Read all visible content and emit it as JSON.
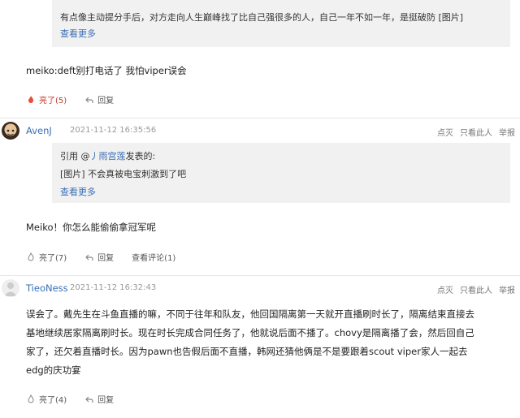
{
  "posts": [
    {
      "quote_text": "有点像主动提分手后，对方走向人生巅峰找了比自己强很多的人，自己一年不如一年，是挺破防 [图片]",
      "quote_more": "查看更多",
      "body": "meiko:deft别打电话了 我怕viper误会",
      "like_label": "亮了(5)",
      "reply_label": "回复"
    },
    {
      "username": "AvenJ",
      "timestamp": "2021-11-12 16:35:56",
      "links": [
        "点灭",
        "只看此人",
        "举报"
      ],
      "quote_prefix": "引用 @",
      "quote_user": "丿雨宫莲",
      "quote_suffix": "发表的:",
      "quote_text": "[图片] 不会真被电宝刺激到了吧",
      "quote_more": "查看更多",
      "body": "Meiko！你怎么能偷偷拿冠军呢",
      "like_label": "亮了(7)",
      "reply_label": "回复",
      "comments_label": "查看评论(1)"
    },
    {
      "username": "TieoNess",
      "timestamp": "2021-11-12 16:32:43",
      "links": [
        "点灭",
        "只看此人",
        "举报"
      ],
      "body_lines": [
        "误会了。戴先生在斗鱼直播的嘛，不同于往年和队友，他回国隔离第一天就开直播刷时长了，隔离结束直接去",
        "基地继续居家隔离刷时长。现在时长完成合同任务了，他就说后面不播了。chovy是隔离播了会，然后回自己",
        "家了，还欠着直播时长。因为pawn也告假后面不直播，韩网还猜他俩是不是要跟着scout viper家人一起去",
        "edg的庆功宴"
      ],
      "like_label": "亮了(4)",
      "reply_label": "回复"
    }
  ],
  "colors": {
    "link": "#3a6fb5",
    "liked": "#c0392b",
    "quote_bg": "#f1f1f1"
  }
}
